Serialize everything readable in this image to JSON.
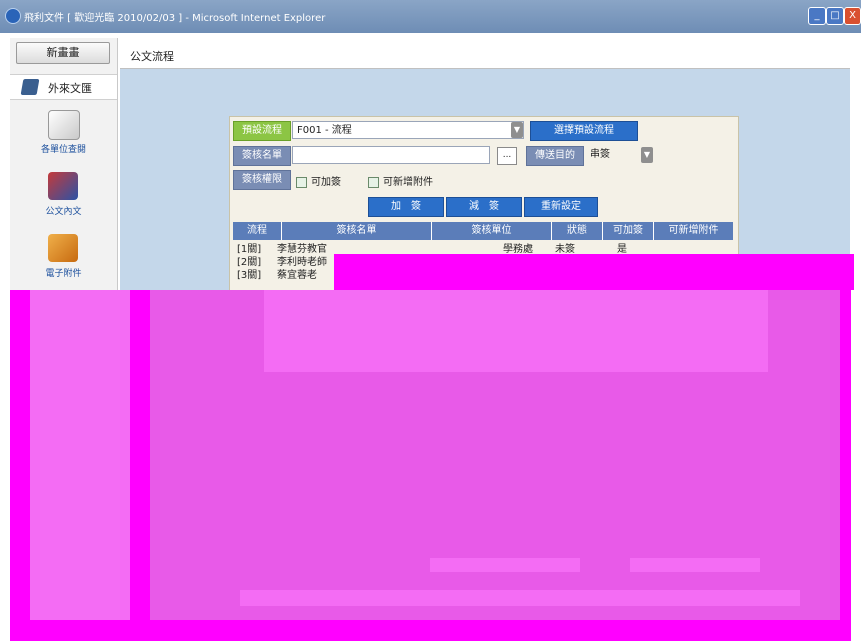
{
  "window": {
    "title": "飛利文件 [ 歡迎光臨 2010/02/03 ] - Microsoft Internet Explorer",
    "controls": [
      "_",
      "□",
      "X"
    ]
  },
  "sidebar": {
    "top_button": "新畫畫",
    "section_label": "外來文匯",
    "items": [
      {
        "label": "各單位查閱",
        "icon": "magnifier-icon"
      },
      {
        "label": "公文內文",
        "icon": "document-icon"
      },
      {
        "label": "電子附件",
        "icon": "disk-icon"
      }
    ]
  },
  "main": {
    "tab_label": "公文流程"
  },
  "form": {
    "flow_label": "預設流程",
    "flow_value": "F001 - 流程",
    "pick_flow_button": "選擇預設流程",
    "approver_label": "簽核名單",
    "approver_value": "",
    "dots_button": "...",
    "purpose_label": "傳送目的",
    "purpose_value": "串簽",
    "permission_label": "簽核權限",
    "perm_add_sign": "可加簽",
    "perm_add_attach": "可新增附件",
    "buttons": {
      "add": "加　簽",
      "reduce": "減　簽",
      "reset": "重新設定"
    },
    "table": {
      "headers": [
        "流程",
        "簽核名單",
        "簽核單位",
        "狀態",
        "可加簽",
        "可新增附件"
      ],
      "rows": [
        {
          "flow": "[1關]",
          "name": "李慧芬教官",
          "unit": "學務處",
          "status": "未簽",
          "add_sign": "是"
        },
        {
          "flow": "[2關]",
          "name": "李利時老師",
          "unit": "",
          "status": "",
          "add_sign": ""
        },
        {
          "flow": "[3關]",
          "name": "蔡宜蓉老",
          "unit": "",
          "status": "",
          "add_sign": ""
        }
      ]
    }
  }
}
